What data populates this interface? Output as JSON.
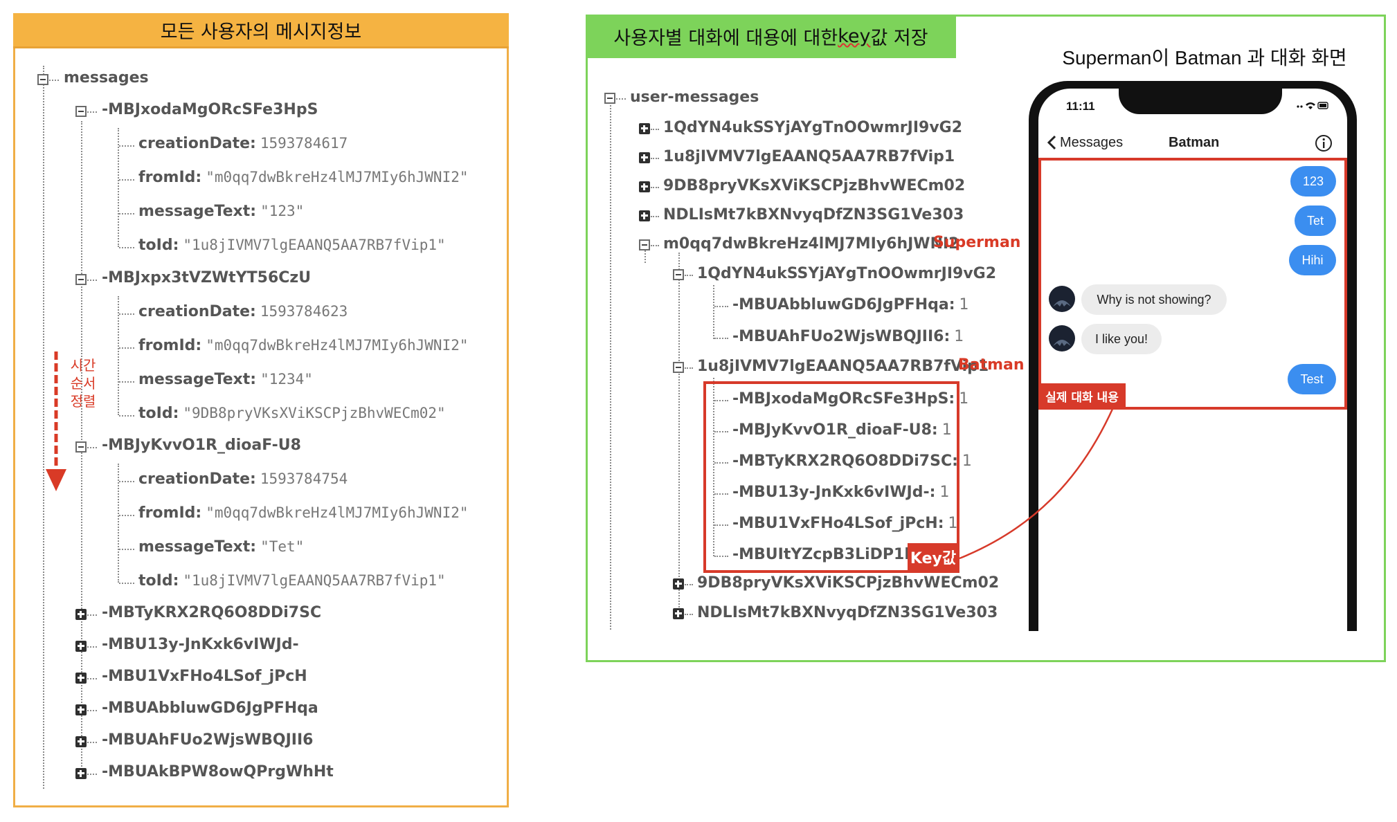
{
  "left": {
    "header": "모든 사용자의 메시지정보",
    "root": "messages",
    "time_note": [
      "시간",
      "순서",
      "정렬"
    ],
    "messages": [
      {
        "key": "-MBJxodaMgORcSFe3HpS",
        "fields": [
          {
            "k": "creationDate:",
            "v": "1593784617"
          },
          {
            "k": "fromId:",
            "v": "\"m0qq7dwBkreHz4lMJ7MIy6hJWNI2\""
          },
          {
            "k": "messageText:",
            "v": "\"123\""
          },
          {
            "k": "toId:",
            "v": "\"1u8jIVMV7lgEAANQ5AA7RB7fVip1\""
          }
        ]
      },
      {
        "key": "-MBJxpx3tVZWtYT56CzU",
        "fields": [
          {
            "k": "creationDate:",
            "v": "1593784623"
          },
          {
            "k": "fromId:",
            "v": "\"m0qq7dwBkreHz4lMJ7MIy6hJWNI2\""
          },
          {
            "k": "messageText:",
            "v": "\"1234\""
          },
          {
            "k": "toId:",
            "v": "\"9DB8pryVKsXViKSCPjzBhvWECm02\""
          }
        ]
      },
      {
        "key": "-MBJyKvvO1R_dioaF-U8",
        "fields": [
          {
            "k": "creationDate:",
            "v": "1593784754"
          },
          {
            "k": "fromId:",
            "v": "\"m0qq7dwBkreHz4lMJ7MIy6hJWNI2\""
          },
          {
            "k": "messageText:",
            "v": "\"Tet\""
          },
          {
            "k": "toId:",
            "v": "\"1u8jIVMV7lgEAANQ5AA7RB7fVip1\""
          }
        ]
      }
    ],
    "collapsed": [
      "-MBTyKRX2RQ6O8DDi7SC",
      "-MBU13y-JnKxk6vIWJd-",
      "-MBU1VxFHo4LSof_jPcH",
      "-MBUAbbluwGD6JgPFHqa",
      "-MBUAhFUo2WjsWBQJII6",
      "-MBUAkBPW8owQPrgWhHt"
    ]
  },
  "right": {
    "header_pre": "사용자별 대화에 대용에 대한 ",
    "header_key": "key",
    "header_post": "값 저장",
    "chat_title": "Superman이 Batman 과 대화 화면",
    "root": "user-messages",
    "users_top": [
      "1QdYN4ukSSYjAYgTnOOwmrJI9vG2",
      "1u8jIVMV7lgEAANQ5AA7RB7fVip1",
      "9DB8pryVKsXViKSCPjzBhvWECm02",
      "NDLIsMt7kBXNvyqDfZN3SG1Ve303"
    ],
    "superman_id": "m0qq7dwBkreHz4lMJ7MIy6hJWNI2",
    "superman_label": "Superman",
    "sub1_id": "1QdYN4ukSSYjAYgTnOOwmrJI9vG2",
    "sub1_entries": [
      {
        "k": "-MBUAbbluwGD6JgPFHqa:",
        "v": "1"
      },
      {
        "k": "-MBUAhFUo2WjsWBQJII6:",
        "v": "1"
      }
    ],
    "sub2_id": "1u8jIVMV7lgEAANQ5AA7RB7fVip1",
    "batman_label": "Batman",
    "sub2_entries": [
      {
        "k": "-MBJxodaMgORcSFe3HpS:",
        "v": "1"
      },
      {
        "k": "-MBJyKvvO1R_dioaF-U8:",
        "v": "1"
      },
      {
        "k": "-MBTyKRX2RQ6O8DDi7SC:",
        "v": "1"
      },
      {
        "k": "-MBU13y-JnKxk6vIWJd-:",
        "v": "1"
      },
      {
        "k": "-MBU1VxFHo4LSof_jPcH:",
        "v": "1"
      },
      {
        "k": "-MBUItYZcpB3LiDP1hKl:",
        "v": ""
      }
    ],
    "sub_bottom": [
      "9DB8pryVKsXViKSCPjzBhvWECm02",
      "NDLIsMt7kBXNvyqDfZN3SG1Ve303"
    ],
    "key_badge": "Key값",
    "real_chat_badge": "실제 대화 내용"
  },
  "phone": {
    "time": "11:11",
    "back_label": "Messages",
    "contact": "Batman",
    "messages": [
      {
        "side": "right",
        "text": "123"
      },
      {
        "side": "right",
        "text": "Tet"
      },
      {
        "side": "right",
        "text": "Hihi"
      },
      {
        "side": "left",
        "text": "Why is not showing?"
      },
      {
        "side": "left",
        "text": "I like you!"
      },
      {
        "side": "right",
        "text": "Test"
      }
    ]
  },
  "colors": {
    "orange": "#f5b342",
    "green": "#7dd35a",
    "red": "#d73a2a",
    "bubble_blue": "#3b8ef0"
  }
}
